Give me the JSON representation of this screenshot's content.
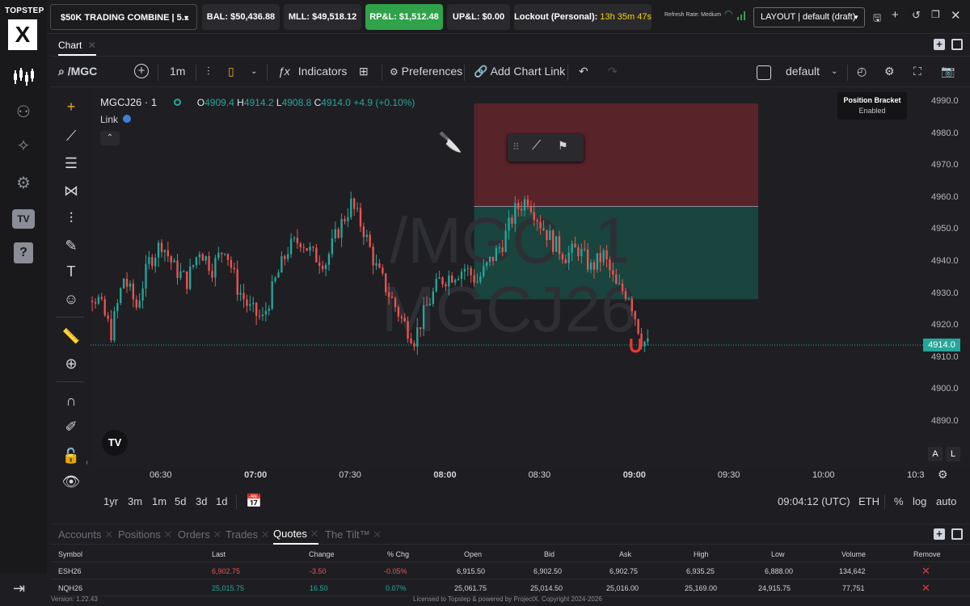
{
  "logo": {
    "brand": "TOPSTEP",
    "mark": "X"
  },
  "topbar": {
    "account": "$50K TRADING COMBINE | 5...",
    "bal": "BAL: $50,436.88",
    "mll": "MLL: $49,518.12",
    "rpl": "RP&L: $1,512.48",
    "upl": "UP&L: $0.00",
    "lockout_label": "Lockout (Personal):",
    "lockout_time": "13h 35m 47s",
    "refresh": "Refresh Rate: Medium",
    "layout": "LAYOUT | default (draft)"
  },
  "chart_tab": "Chart",
  "toolbar": {
    "symbol": "/MGC",
    "interval": "1m",
    "indicators": "Indicators",
    "preferences": "Preferences",
    "add_link": "Add Chart Link",
    "layout_name": "default"
  },
  "legend": {
    "ticker": "MGCJ26 · 1",
    "o_label": "O",
    "o": "4909.4",
    "h_label": "H",
    "h": "4914.2",
    "l_label": "L",
    "l": "4908.8",
    "c_label": "C",
    "c": "4914.0",
    "chg": "+4.9 (+0.10%)",
    "link": "Link"
  },
  "watermark": {
    "line1": "/MGC, 1",
    "line2": "MGCJ26"
  },
  "position_bracket": {
    "title": "Position Bracket",
    "status": "Enabled"
  },
  "yaxis": {
    "ticks": [
      "4990.0",
      "4980.0",
      "4970.0",
      "4960.0",
      "4950.0",
      "4940.0",
      "4930.0",
      "4920.0",
      "4910.0",
      "4900.0",
      "4890.0"
    ],
    "last_price": "4914.0",
    "a_btn": "A",
    "l_btn": "L"
  },
  "xaxis": {
    "ticks": [
      "06:30",
      "07:00",
      "07:30",
      "08:00",
      "08:30",
      "09:00",
      "09:30",
      "10:00",
      "10:3"
    ]
  },
  "rangebar": {
    "ranges": [
      "1yr",
      "3m",
      "1m",
      "5d",
      "3d",
      "1d"
    ],
    "time": "09:04:12 (UTC)",
    "session": "ETH",
    "pct": "%",
    "log": "log",
    "auto": "auto"
  },
  "bottom_tabs": [
    "Accounts",
    "Positions",
    "Orders",
    "Trades",
    "Quotes",
    "The Tilt™"
  ],
  "quotes": {
    "headers": [
      "Symbol",
      "Last",
      "Change",
      "% Chg",
      "Open",
      "Bid",
      "Ask",
      "High",
      "Low",
      "Volume",
      "Remove"
    ],
    "rows": [
      {
        "symbol": "ESH26",
        "last": "6,902.75",
        "change": "-3.50",
        "pchg": "-0.05%",
        "open": "6,915.50",
        "bid": "6,902.50",
        "ask": "6,902.75",
        "high": "6,935.25",
        "low": "6,888.00",
        "volume": "134,642"
      },
      {
        "symbol": "NQH26",
        "last": "25,015.75",
        "change": "16.50",
        "pchg": "0.07%",
        "open": "25,061.75",
        "bid": "25,014.50",
        "ask": "25,016.00",
        "high": "25,169.00",
        "low": "24,915.75",
        "volume": "77,751"
      }
    ]
  },
  "footer": {
    "version": "Version: 1.22.43",
    "license": "Licensed to Topstep & powered by ProjectX. Copyright 2024-2026"
  },
  "chart_data": {
    "type": "candlestick",
    "ylim": [
      4884,
      5000
    ],
    "xlim": [
      "06:00",
      "10:35"
    ],
    "up_color": "#26a69a",
    "down_color": "#ef5350",
    "close_path": [
      [
        "06:00",
        4910
      ],
      [
        "06:04",
        4933
      ],
      [
        "06:10",
        4928
      ],
      [
        "06:14",
        4918
      ],
      [
        "06:18",
        4935
      ],
      [
        "06:22",
        4926
      ],
      [
        "06:26",
        4940
      ],
      [
        "06:30",
        4946
      ],
      [
        "06:34",
        4938
      ],
      [
        "06:38",
        4934
      ],
      [
        "06:42",
        4944
      ],
      [
        "06:46",
        4938
      ],
      [
        "06:50",
        4945
      ],
      [
        "06:54",
        4932
      ],
      [
        "06:58",
        4925
      ],
      [
        "07:02",
        4922
      ],
      [
        "07:06",
        4934
      ],
      [
        "07:10",
        4944
      ],
      [
        "07:14",
        4947
      ],
      [
        "07:18",
        4942
      ],
      [
        "07:22",
        4940
      ],
      [
        "07:26",
        4950
      ],
      [
        "07:30",
        4958
      ],
      [
        "07:34",
        4950
      ],
      [
        "07:38",
        4938
      ],
      [
        "07:42",
        4930
      ],
      [
        "07:46",
        4922
      ],
      [
        "07:50",
        4916
      ],
      [
        "07:54",
        4926
      ],
      [
        "07:58",
        4934
      ],
      [
        "08:02",
        4936
      ],
      [
        "08:06",
        4938
      ],
      [
        "08:10",
        4934
      ],
      [
        "08:14",
        4940
      ],
      [
        "08:18",
        4946
      ],
      [
        "08:22",
        4956
      ],
      [
        "08:26",
        4960
      ],
      [
        "08:30",
        4952
      ],
      [
        "08:34",
        4946
      ],
      [
        "08:38",
        4942
      ],
      [
        "08:42",
        4944
      ],
      [
        "08:46",
        4938
      ],
      [
        "08:50",
        4942
      ],
      [
        "08:54",
        4932
      ],
      [
        "08:58",
        4930
      ],
      [
        "09:02",
        4916
      ],
      [
        "09:04",
        4914
      ]
    ],
    "stop_zone": {
      "low": 4957.3,
      "high": 4989.5,
      "from": "08:09",
      "to": "09:39"
    },
    "target_zone": {
      "low": 4928.3,
      "high": 4957.3,
      "from": "08:09",
      "to": "09:39"
    }
  }
}
